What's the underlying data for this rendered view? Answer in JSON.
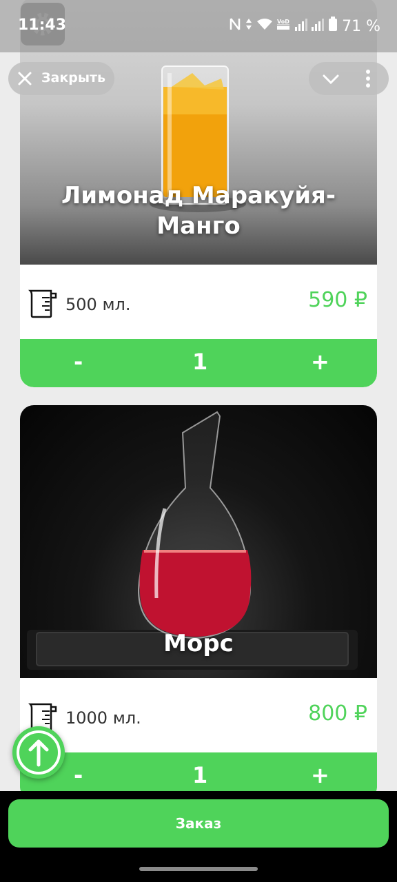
{
  "status_bar": {
    "time": "11:43",
    "battery": "71 %",
    "icons": [
      "nfc-icon",
      "data-arrows-icon",
      "wifi-icon",
      "volte-icon",
      "signal-icon",
      "signal-icon",
      "battery-icon"
    ],
    "volte_text": "VoD LTE"
  },
  "header": {
    "close_label": "Закрыть",
    "icons": [
      "close-icon",
      "chevron-down-icon",
      "more-vertical-icon",
      "gear-icon"
    ]
  },
  "products": [
    {
      "title": "Лимонад Маракуйя-Манго",
      "volume": "500 мл.",
      "price": "590 ₽",
      "minus": "-",
      "quantity": "1",
      "plus": "+"
    },
    {
      "title": "Морс",
      "volume": "1000 мл.",
      "price": "800 ₽",
      "minus": "-",
      "quantity": "1",
      "plus": "+"
    }
  ],
  "footer": {
    "order_label": "Заказ"
  },
  "colors": {
    "accent_green": "#4fd35a",
    "price_green": "#4fd35a",
    "background": "#ececec"
  }
}
